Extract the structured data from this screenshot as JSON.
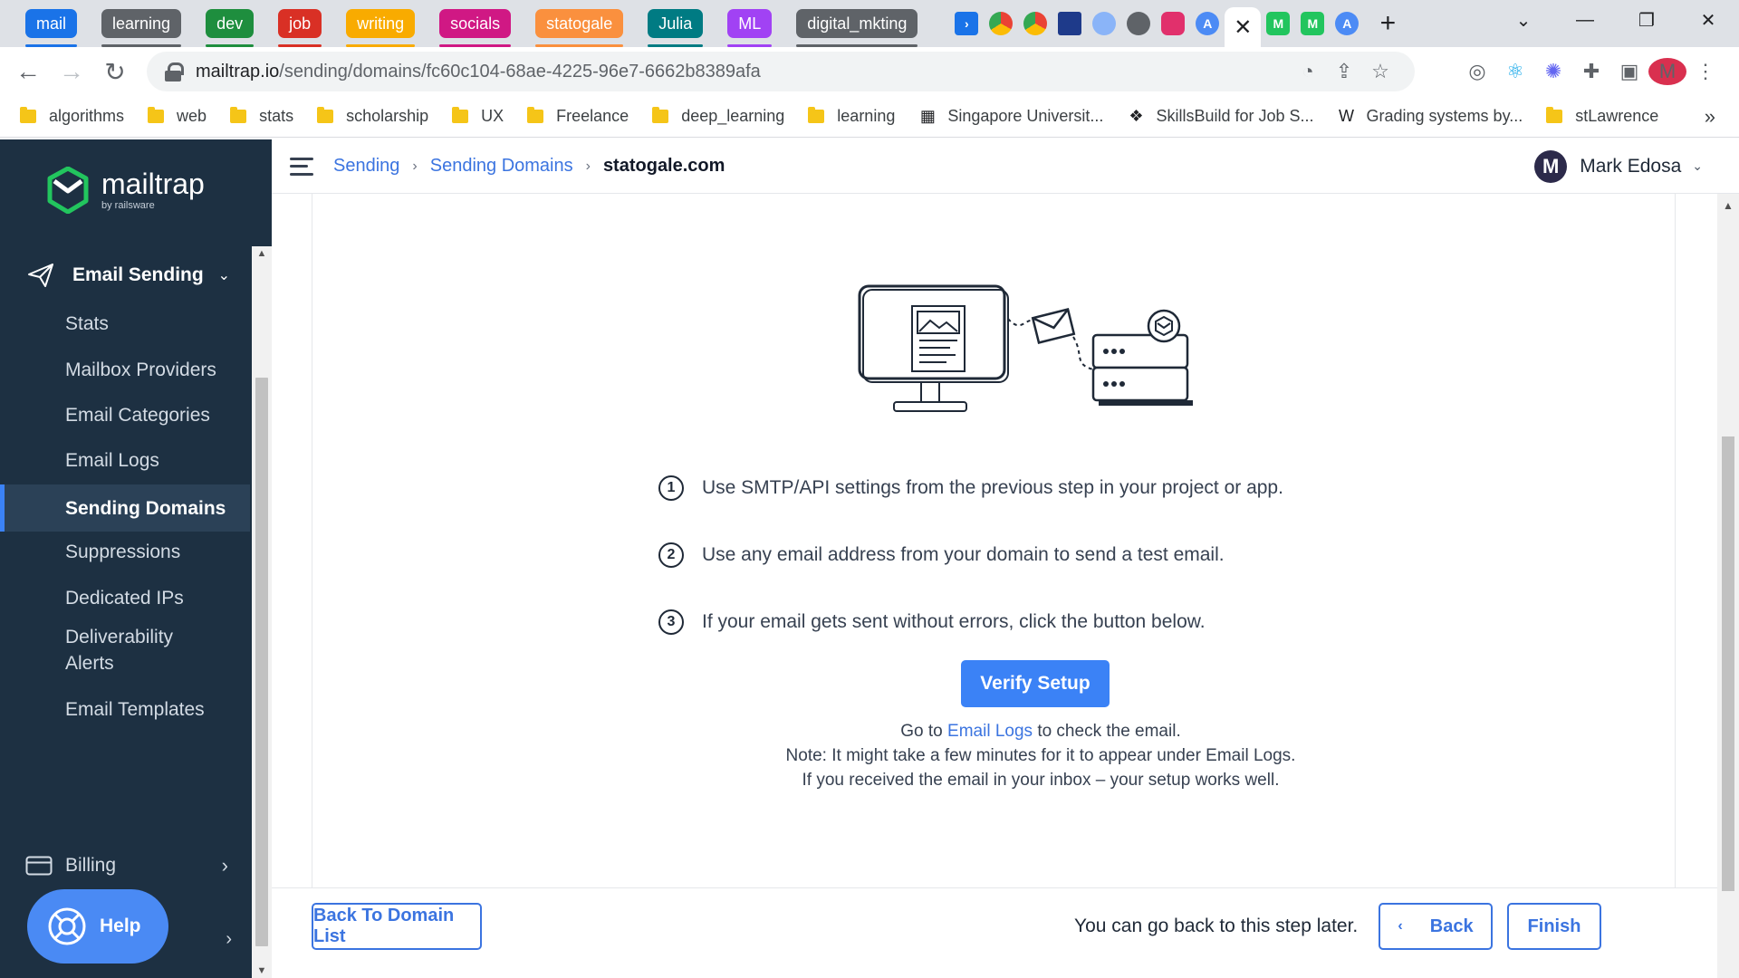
{
  "browser": {
    "tab_groups": [
      {
        "label": "mail",
        "color": "#1a73e8"
      },
      {
        "label": "learning",
        "color": "#5f6368"
      },
      {
        "label": "dev",
        "color": "#1e8e3e"
      },
      {
        "label": "job",
        "color": "#d93025"
      },
      {
        "label": "writing",
        "color": "#f9ab00"
      },
      {
        "label": "socials",
        "color": "#d01884"
      },
      {
        "label": "statogale",
        "color": "#fa903e"
      },
      {
        "label": "Julia",
        "color": "#007b83"
      },
      {
        "label": "ML",
        "color": "#a142f4"
      },
      {
        "label": "digital_mkting",
        "color": "#5f6368"
      }
    ],
    "active_tab_icon": "close-icon",
    "url_host": "mailtrap.io",
    "url_path": "/sending/domains/fc60c104-68ae-4225-96e7-6662b8389afa",
    "profile_initial": "M",
    "bookmarks": [
      {
        "label": "algorithms",
        "icon": "folder-icon"
      },
      {
        "label": "web",
        "icon": "folder-icon"
      },
      {
        "label": "stats",
        "icon": "folder-icon"
      },
      {
        "label": "scholarship",
        "icon": "folder-icon"
      },
      {
        "label": "UX",
        "icon": "folder-icon"
      },
      {
        "label": "Freelance",
        "icon": "folder-icon"
      },
      {
        "label": "deep_learning",
        "icon": "folder-icon"
      },
      {
        "label": "learning",
        "icon": "folder-icon"
      },
      {
        "label": "Singapore Universit...",
        "icon": "university-icon"
      },
      {
        "label": "SkillsBuild for Job S...",
        "icon": "skillsbuild-icon"
      },
      {
        "label": "Grading systems by...",
        "icon": "wikipedia-icon"
      },
      {
        "label": "stLawrence",
        "icon": "folder-icon"
      }
    ],
    "bookmarks_more": "»"
  },
  "sidebar": {
    "logo_name": "mailtrap",
    "logo_sub": "by railsware",
    "section_label": "Email Sending",
    "items": [
      {
        "label": "Stats",
        "active": false
      },
      {
        "label": "Mailbox Providers",
        "active": false
      },
      {
        "label": "Email Categories",
        "active": false
      },
      {
        "label": "Email Logs",
        "active": false
      },
      {
        "label": "Sending Domains",
        "active": true
      },
      {
        "label": "Suppressions",
        "active": false
      },
      {
        "label": "Dedicated IPs",
        "active": false
      },
      {
        "label": "Deliverability Alerts",
        "active": false
      },
      {
        "label": "Email Templates",
        "active": false
      }
    ],
    "billing_label": "Billing",
    "help_label": "Help"
  },
  "header": {
    "breadcrumb": [
      "Sending",
      "Sending Domains",
      "statogale.com"
    ],
    "user_initial": "M",
    "user_name": "Mark Edosa"
  },
  "main": {
    "steps": [
      {
        "num": "1",
        "text": "Use SMTP/API settings from the previous step in your project or app."
      },
      {
        "num": "2",
        "text": "Use any email address from your domain to send a test email."
      },
      {
        "num": "3",
        "text": "If your email gets sent without errors, click the button below."
      }
    ],
    "verify_label": "Verify Setup",
    "note_prefix": "Go to",
    "note_link": "Email Logs",
    "note_suffix": "to check the email.",
    "note_line2": "Note: It might take a few minutes for it to appear under Email Logs.",
    "note_line3": "If you received the email in your inbox – your setup works well."
  },
  "footer": {
    "back_to_list_label": "Back To Domain List",
    "note": "You can go back to this step later.",
    "back_label": "Back",
    "finish_label": "Finish"
  }
}
